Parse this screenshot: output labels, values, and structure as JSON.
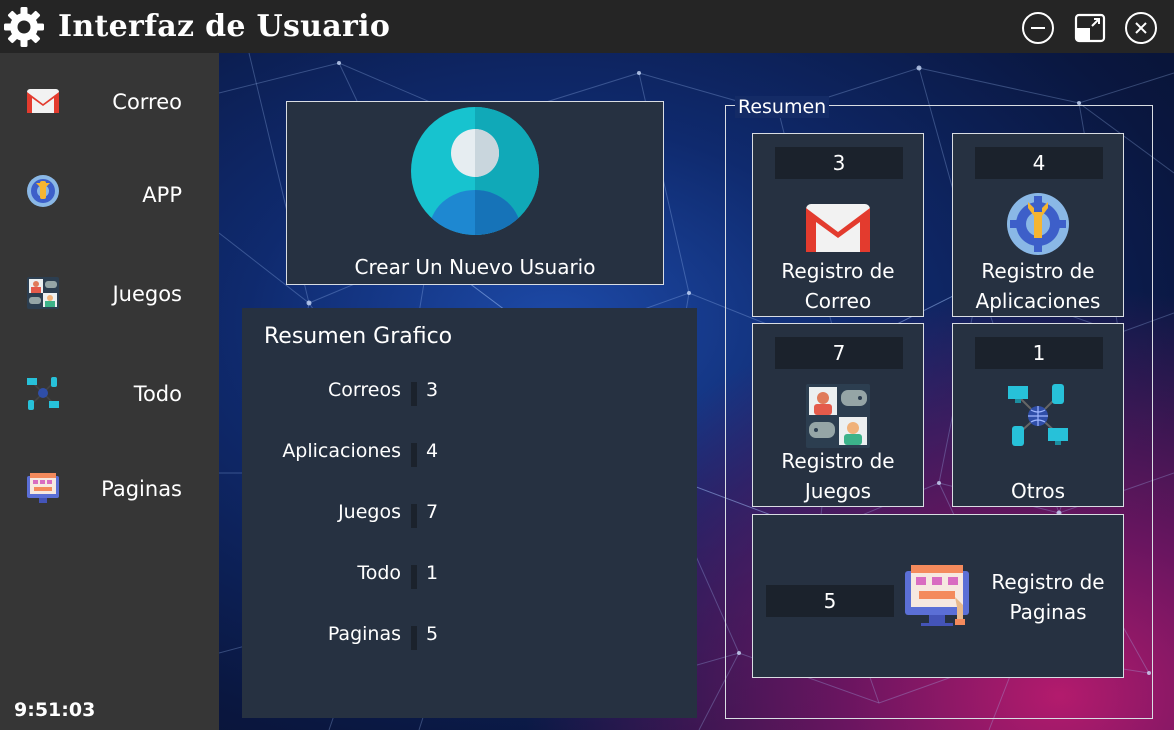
{
  "window": {
    "title": "Interfaz de Usuario",
    "icon": "gear-icon",
    "controls": [
      "minimize-icon",
      "restore-icon",
      "close-icon"
    ]
  },
  "sidebar": {
    "items": [
      {
        "label": "Correo",
        "icon": "gmail-icon"
      },
      {
        "label": "APP",
        "icon": "app-gear-icon"
      },
      {
        "label": "Juegos",
        "icon": "gamers-icon"
      },
      {
        "label": "Todo",
        "icon": "network-icon"
      },
      {
        "label": "Paginas",
        "icon": "webpage-icon"
      }
    ],
    "clock": "9:51:03"
  },
  "create_user": {
    "label": "Crear Un Nuevo Usuario",
    "icon": "user-avatar-icon"
  },
  "grafico": {
    "title": "Resumen Grafico",
    "rows": [
      {
        "label": "Correos",
        "value": "3"
      },
      {
        "label": "Aplicaciones",
        "value": "4"
      },
      {
        "label": "Juegos",
        "value": "7"
      },
      {
        "label": "Todo",
        "value": "1"
      },
      {
        "label": "Paginas",
        "value": "5"
      }
    ]
  },
  "resumen": {
    "legend": "Resumen",
    "tiles": [
      {
        "count": "3",
        "line1": "Registro de",
        "line2": "Correo",
        "icon": "gmail-icon"
      },
      {
        "count": "4",
        "line1": "Registro de",
        "line2": "Aplicaciones",
        "icon": "app-gear-icon"
      },
      {
        "count": "7",
        "line1": "Registro de",
        "line2": "Juegos",
        "icon": "gamers-icon"
      },
      {
        "count": "1",
        "line1": "",
        "line2": "Otros",
        "icon": "network-icon"
      }
    ],
    "wide_tile": {
      "count": "5",
      "line1": "Registro de",
      "line2": "Paginas",
      "icon": "webpage-icon"
    }
  },
  "colors": {
    "titlebar": "#252525",
    "sidebar": "#363636",
    "panel": "#263141",
    "count_box": "#1b222c",
    "border": "#d9dde3"
  }
}
